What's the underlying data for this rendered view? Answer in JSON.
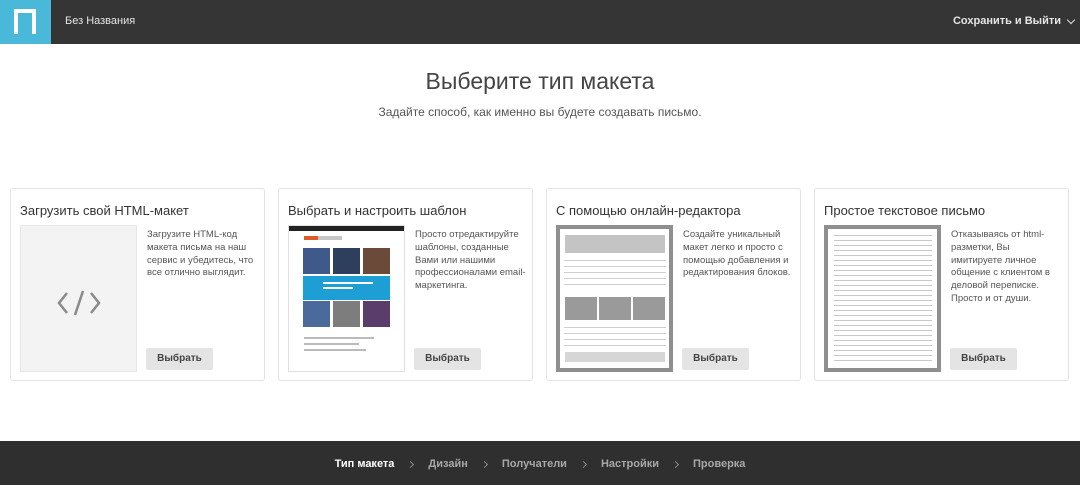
{
  "header": {
    "doc_title": "Без Названия",
    "save_exit_label": "Сохранить и Выйти"
  },
  "main": {
    "title": "Выберите тип макета",
    "subtitle": "Задайте способ, как именно вы будете создавать письмо."
  },
  "cards": [
    {
      "title": "Загрузить свой HTML-макет",
      "description": "Загрузите HTML-код макета письма на наш сервис и убедитесь, что все отлично выглядит.",
      "button": "Выбрать",
      "icon": "code-icon"
    },
    {
      "title": "Выбрать и настроить шаблон",
      "description": "Просто отредактируйте шаблоны, созданные Вами или нашими профессионалами email-маркетинга.",
      "button": "Выбрать"
    },
    {
      "title": "С помощью онлайн-редактора",
      "description": "Создайте уникальный макет легко и просто с помощью добавления и редактирования блоков.",
      "button": "Выбрать"
    },
    {
      "title": "Простое текстовое письмо",
      "description": "Отказываясь от html-разметки, Вы имитируете личное общение с клиентом в деловой переписке. Просто и от души.",
      "button": "Выбрать"
    }
  ],
  "footer": {
    "steps": [
      "Тип макета",
      "Дизайн",
      "Получатели",
      "Настройки",
      "Проверка"
    ],
    "active_step": "Тип макета"
  },
  "colors": {
    "topbar": "#353535",
    "logo_accent": "#4ab8d8",
    "footer": "#2f2f2f",
    "button": "#e4e4e4"
  }
}
